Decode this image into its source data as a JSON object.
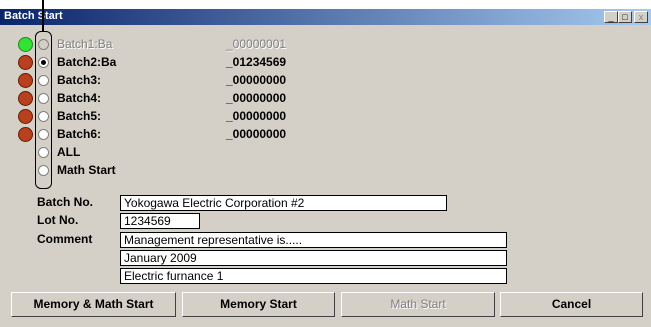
{
  "window": {
    "title": "Batch Start",
    "minimize_glyph": "_",
    "maximize_glyph": "□",
    "close_glyph": "x"
  },
  "batches": [
    {
      "label": "Batch1:Ba",
      "number": "_00000001",
      "lamp": "green",
      "selected": false,
      "disabled": true
    },
    {
      "label": "Batch2:Ba",
      "number": "_01234569",
      "lamp": "red",
      "selected": true,
      "disabled": false
    },
    {
      "label": "Batch3:",
      "number": "_00000000",
      "lamp": "red",
      "selected": false,
      "disabled": false
    },
    {
      "label": "Batch4:",
      "number": "_00000000",
      "lamp": "red",
      "selected": false,
      "disabled": false
    },
    {
      "label": "Batch5:",
      "number": "_00000000",
      "lamp": "red",
      "selected": false,
      "disabled": false
    },
    {
      "label": "Batch6:",
      "number": "_00000000",
      "lamp": "red",
      "selected": false,
      "disabled": false
    }
  ],
  "extra_options": [
    {
      "label": "ALL",
      "selected": false
    },
    {
      "label": "Math Start",
      "selected": false
    }
  ],
  "form": {
    "batch_no_label": "Batch No.",
    "batch_no_value": "Yokogawa Electric Corporation #2",
    "lot_no_label": "Lot No.",
    "lot_no_value": "1234569",
    "comment_label": "Comment",
    "comment_lines": [
      "Management representative is.....",
      "January 2009",
      "Electric furnance 1"
    ]
  },
  "buttons": {
    "memory_math_start": "Memory & Math Start",
    "memory_start": "Memory Start",
    "math_start": "Math Start",
    "cancel": "Cancel"
  },
  "colors": {
    "lamp_green": "#33e233",
    "lamp_red": "#b8401f",
    "title_bar": "#0a246a",
    "dialog_bg": "#d4d0c8"
  }
}
